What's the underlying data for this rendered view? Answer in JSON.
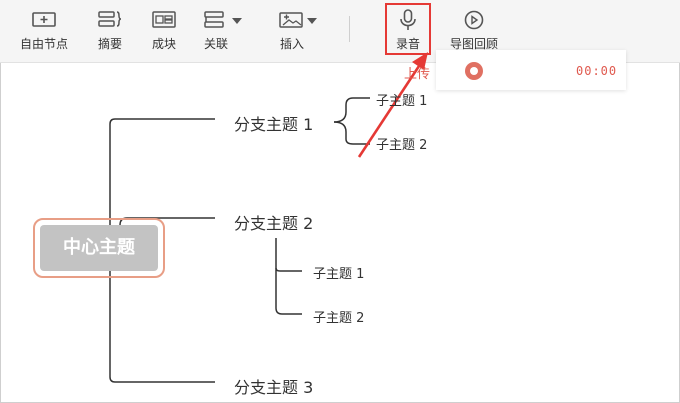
{
  "toolbar": {
    "items": [
      {
        "label": "自由节点",
        "icon": "free-node-icon"
      },
      {
        "label": "摘要",
        "icon": "summary-icon"
      },
      {
        "label": "成块",
        "icon": "block-icon"
      },
      {
        "label": "关联",
        "icon": "relation-icon"
      },
      {
        "label": "插入",
        "icon": "insert-icon"
      },
      {
        "label": "录音",
        "icon": "microphone-icon"
      },
      {
        "label": "导图回顾",
        "icon": "play-circle-icon"
      }
    ]
  },
  "recording_panel": {
    "upload_label": "上传",
    "timer": "00:00"
  },
  "mindmap": {
    "central": "中心主题",
    "branches": [
      {
        "label": "分支主题 1",
        "children": [
          "子主题 1",
          "子主题 2"
        ]
      },
      {
        "label": "分支主题 2",
        "children": [
          "子主题 1",
          "子主题 2"
        ]
      },
      {
        "label": "分支主题 3",
        "children": []
      }
    ]
  },
  "colors": {
    "highlight_box": "#e53935",
    "accent": "#e05a4f",
    "central_ring": "#e89e86",
    "central_fill": "#c3c3c3"
  }
}
